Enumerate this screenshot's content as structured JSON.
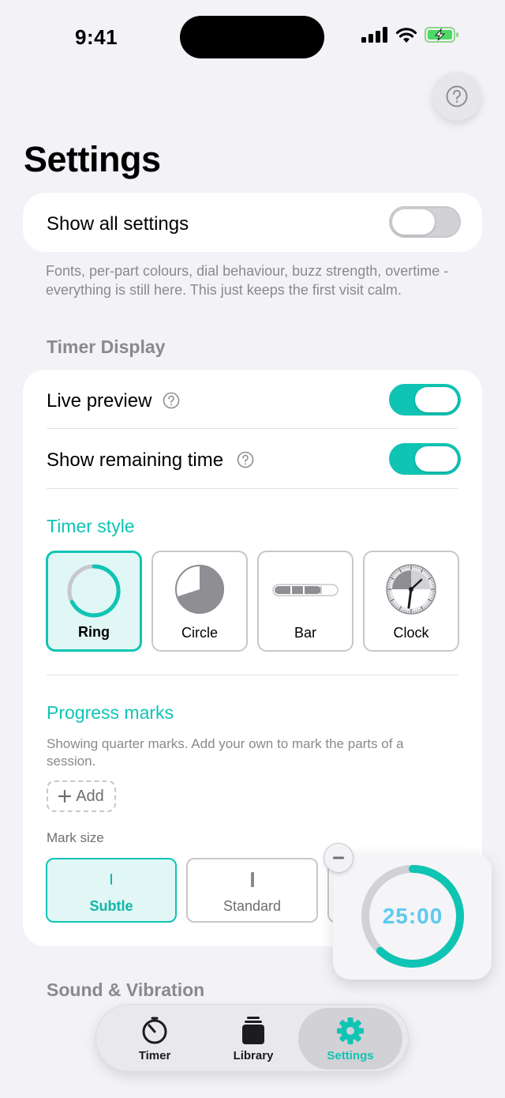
{
  "status_bar": {
    "time": "9:41"
  },
  "page": {
    "title": "Settings"
  },
  "show_all": {
    "label": "Show all settings",
    "enabled": false,
    "footnote": "Fonts, per-part colours, dial behaviour, buzz strength, overtime - everything is still here. This just keeps the first visit calm."
  },
  "timer_display": {
    "header": "Timer Display",
    "live_preview": {
      "label": "Live preview",
      "enabled": true
    },
    "show_remaining": {
      "label": "Show remaining time",
      "enabled": true
    },
    "timer_style": {
      "title": "Timer style",
      "options": [
        {
          "label": "Ring",
          "selected": true
        },
        {
          "label": "Circle",
          "selected": false
        },
        {
          "label": "Bar",
          "selected": false
        },
        {
          "label": "Clock",
          "selected": false
        }
      ]
    },
    "progress_marks": {
      "title": "Progress marks",
      "description": "Showing quarter marks. Add your own to mark the parts of a session.",
      "add_label": "Add",
      "mark_size_label": "Mark size",
      "sizes": [
        {
          "label": "Subtle",
          "selected": true
        },
        {
          "label": "Standard",
          "selected": false
        }
      ]
    }
  },
  "sound_vibration": {
    "header": "Sound & Vibration"
  },
  "timer_widget": {
    "time": "25:00",
    "progress": 0.62
  },
  "tab_bar": {
    "tabs": [
      {
        "label": "Timer",
        "icon": "stopwatch-icon",
        "active": false
      },
      {
        "label": "Library",
        "icon": "library-icon",
        "active": false
      },
      {
        "label": "Settings",
        "icon": "gear-icon",
        "active": true
      }
    ]
  },
  "colors": {
    "accent": "#10c4b4",
    "timer_text": "#5ccaf0",
    "background": "#f2f2f7"
  }
}
